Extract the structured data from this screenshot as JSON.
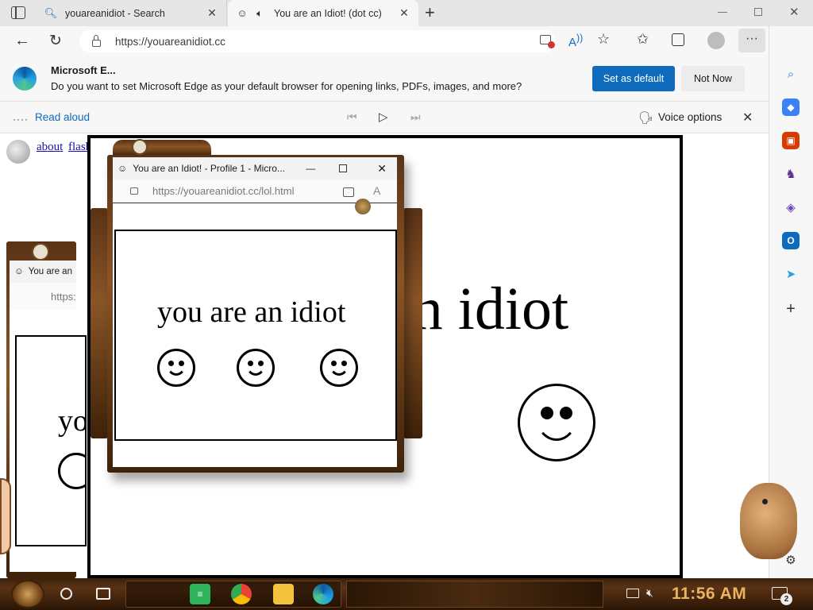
{
  "browser": {
    "tabs": [
      {
        "title": "youareanidiot - Search",
        "icon": "search-icon"
      },
      {
        "title": "You are an Idiot! (dot cc)",
        "icon": "smiley-icon"
      }
    ],
    "new_tab_label": "+",
    "url": "https://youareanidiot.cc"
  },
  "infobar": {
    "title": "Microsoft E...",
    "message": "Do you want to set Microsoft Edge as your default browser for opening links, PDFs, images, and more?",
    "primary_button": "Set as default",
    "secondary_button": "Not Now"
  },
  "read_aloud": {
    "label": "Read aloud",
    "voice_options": "Voice options"
  },
  "page": {
    "links": [
      "about",
      "flash"
    ],
    "main_text": "an idiot",
    "popup_text": "you are an idiot",
    "partial_text": "yo"
  },
  "popup_window": {
    "title": "You are an Idiot! - Profile 1 - Micro...",
    "url": "https://youareanidiot.cc/lol.html"
  },
  "back_window": {
    "title": "You are an",
    "url": "https:"
  },
  "taskbar": {
    "time": "11:56 AM",
    "notification_count": "2"
  },
  "colors": {
    "accent": "#0f6cbd",
    "frame_brown": "#5a3316",
    "clock": "#e8b460"
  }
}
